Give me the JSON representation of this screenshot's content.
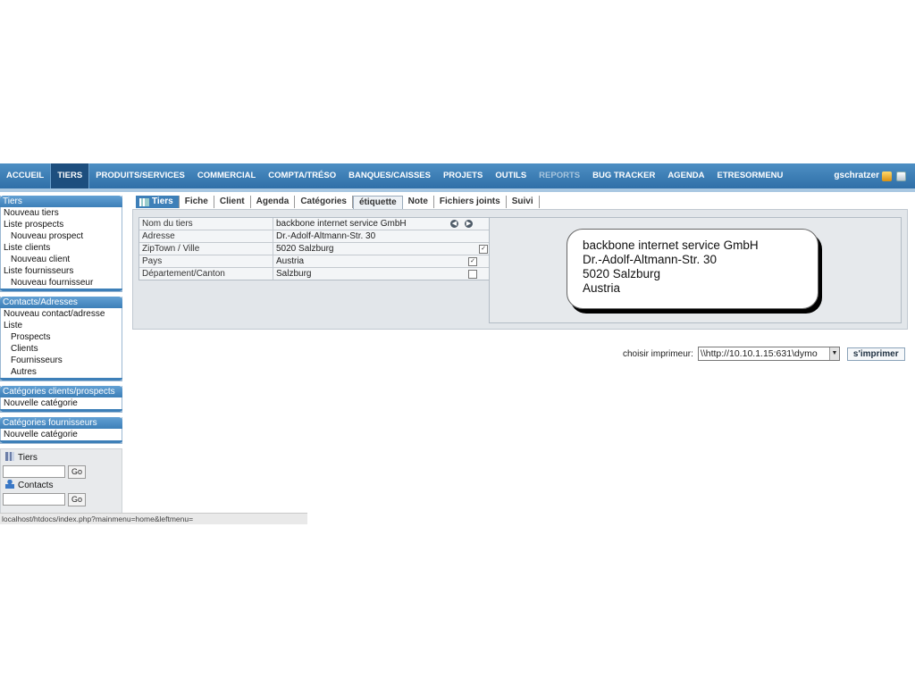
{
  "topmenu": {
    "items": [
      "ACCUEIL",
      "TIERS",
      "PRODUITS/SERVICES",
      "COMMERCIAL",
      "COMPTA/TRÉSO",
      "BANQUES/CAISSES",
      "PROJETS",
      "OUTILS",
      "REPORTS",
      "BUG TRACKER",
      "AGENDA",
      "ETRESORMENU"
    ],
    "active": "TIERS",
    "user": "gschratzer"
  },
  "leftmenu": {
    "tiers": {
      "title": "Tiers",
      "items": [
        "Nouveau tiers",
        "Liste prospects",
        "Nouveau prospect",
        "Liste clients",
        "Nouveau client",
        "Liste fournisseurs",
        "Nouveau fournisseur"
      ]
    },
    "contacts": {
      "title": "Contacts/Adresses",
      "items": [
        "Nouveau contact/adresse",
        "Liste",
        "Prospects",
        "Clients",
        "Fournisseurs",
        "Autres"
      ]
    },
    "categories_clients": {
      "title": "Catégories clients/prospects",
      "items": [
        "Nouvelle catégorie"
      ]
    },
    "categories_fournisseurs": {
      "title": "Catégories fournisseurs",
      "items": [
        "Nouvelle catégorie"
      ]
    },
    "search": {
      "tiers_label": "Tiers",
      "contacts_label": "Contacts",
      "go": "Go"
    }
  },
  "tabs": [
    "Tiers",
    "Fiche",
    "Client",
    "Agenda",
    "Catégories",
    "étiquette",
    "Note",
    "Fichiers joints",
    "Suivi"
  ],
  "active_tab": "étiquette",
  "fields": [
    {
      "label": "Nom du tiers",
      "value": "backbone internet service GmbH"
    },
    {
      "label": "Adresse",
      "value": "Dr.-Adolf-Altmann-Str. 30"
    },
    {
      "label": "ZipTown / Ville",
      "value": "5020 Salzburg",
      "checked": true
    },
    {
      "label": "Pays",
      "value": "Austria",
      "checked": true
    },
    {
      "label": "Département/Canton",
      "value": "Salzburg",
      "checked": false
    }
  ],
  "label_preview": [
    "backbone internet service GmbH",
    "Dr.-Adolf-Altmann-Str. 30",
    "5020 Salzburg",
    "Austria"
  ],
  "printer": {
    "label": "choisir imprimeur:",
    "selected": "\\\\http://10.10.1.15:631\\dymo",
    "button": "s'imprimer"
  },
  "status_url": "localhost/htdocs/index.php?mainmenu=home&leftmenu="
}
